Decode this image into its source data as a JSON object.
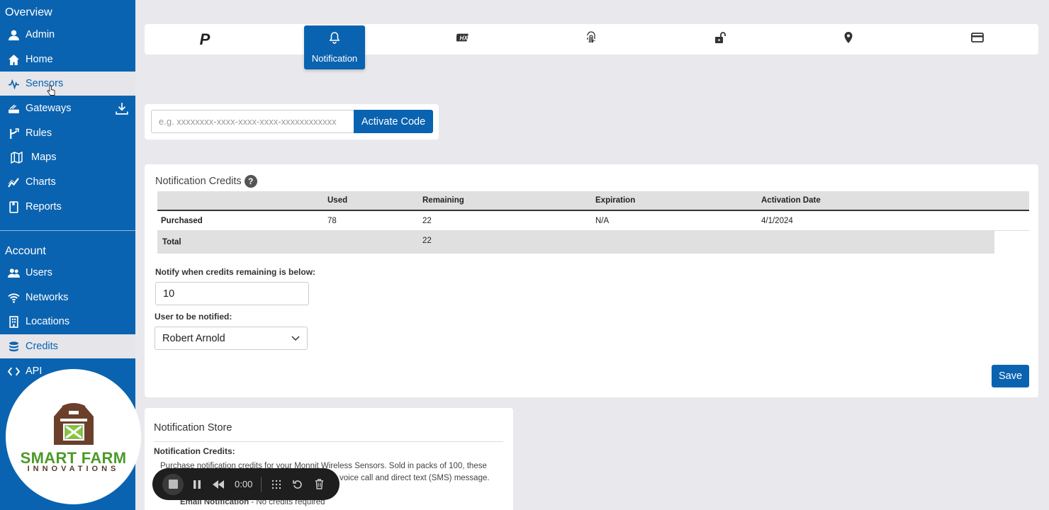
{
  "sidebar": {
    "overview_heading": "Overview",
    "overview_items": [
      {
        "label": "Admin",
        "icon": "admin-icon"
      },
      {
        "label": "Home",
        "icon": "home-icon"
      },
      {
        "label": "Sensors",
        "icon": "sensors-icon",
        "active": true
      },
      {
        "label": "Gateways",
        "icon": "gateways-icon"
      },
      {
        "label": "Rules",
        "icon": "rules-icon"
      },
      {
        "label": "Maps",
        "icon": "maps-icon"
      },
      {
        "label": "Charts",
        "icon": "charts-icon"
      },
      {
        "label": "Reports",
        "icon": "reports-icon"
      }
    ],
    "account_heading": "Account",
    "account_items": [
      {
        "label": "Users",
        "icon": "users-icon"
      },
      {
        "label": "Networks",
        "icon": "networks-icon"
      },
      {
        "label": "Locations",
        "icon": "locations-icon"
      },
      {
        "label": "Credits",
        "icon": "credits-icon",
        "active": true
      },
      {
        "label": "API",
        "icon": "api-icon"
      }
    ]
  },
  "logo": {
    "line1": "SMART FARM",
    "line2": "INNOVATIONS"
  },
  "tabs": [
    {
      "icon": "premiere-p-icon"
    },
    {
      "icon": "bell-icon",
      "label": "Notification",
      "active": true
    },
    {
      "icon": "hx-icon"
    },
    {
      "icon": "fingerprint-icon"
    },
    {
      "icon": "unlock-icon"
    },
    {
      "icon": "map-pin-icon"
    },
    {
      "icon": "credit-card-icon"
    }
  ],
  "activation": {
    "placeholder": "e.g. xxxxxxxx-xxxx-xxxx-xxxx-xxxxxxxxxxxx",
    "button_label": "Activate Code"
  },
  "credits": {
    "title": "Notification Credits",
    "help": "?",
    "columns": [
      "Used",
      "Remaining",
      "Expiration",
      "Activation Date"
    ],
    "rows": [
      {
        "label": "Purchased",
        "used": "78",
        "remaining": "22",
        "expiration": "N/A",
        "activation": "4/1/2024"
      }
    ],
    "total": {
      "label": "Total",
      "remaining": "22"
    },
    "notify_label": "Notify when credits remaining is below:",
    "notify_value": "10",
    "user_label": "User to be notified:",
    "user_value": "Robert Arnold",
    "save_label": "Save"
  },
  "store": {
    "title": "Notification Store",
    "subtitle": "Notification Credits:",
    "line1": "Purchase notification credits for your Monnit Wireless Sensors. Sold in packs of 100, these",
    "line2": "voice call and direct text (SMS) message.",
    "email_bold": "Email Notification",
    "email_rest": " - No credits required"
  },
  "recorder": {
    "time": "0:00"
  },
  "colors": {
    "brand": "#0a63b0",
    "sidebar_active_bg": "#e5e5ea",
    "logo_green": "#4c9a2a",
    "logo_brown": "#5a3b2a"
  }
}
